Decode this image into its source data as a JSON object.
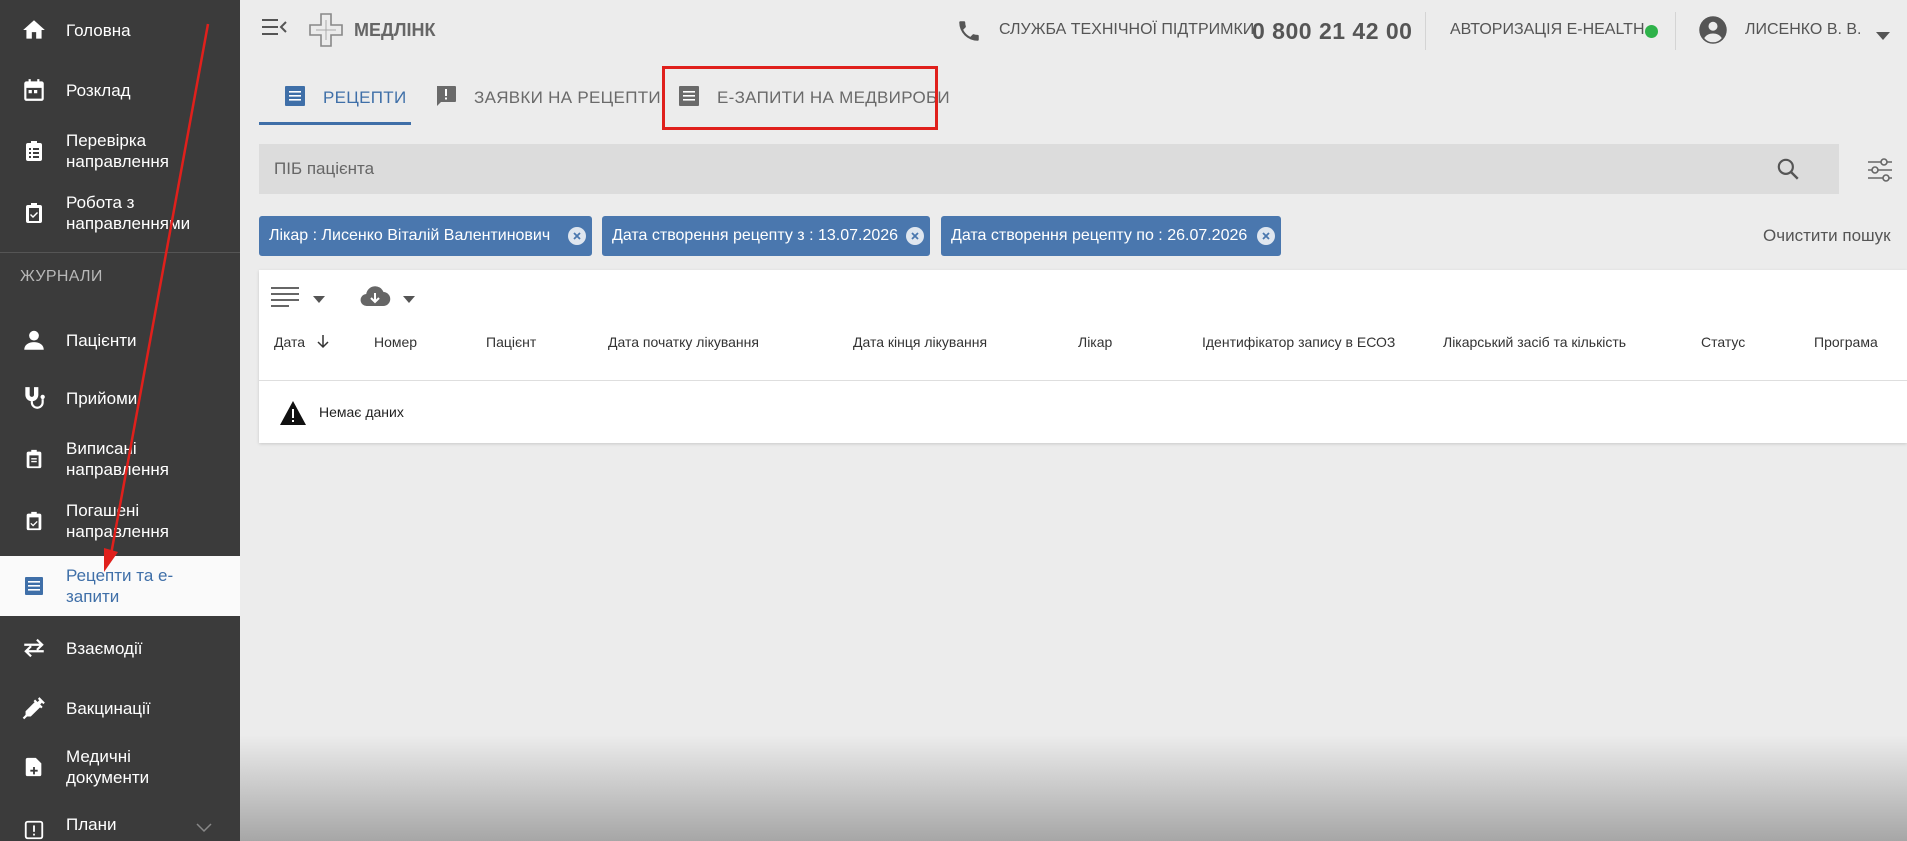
{
  "sidebar": {
    "items": [
      {
        "label": "Головна",
        "icon": "home-icon"
      },
      {
        "label": "Розклад",
        "icon": "calendar-icon"
      },
      {
        "label": "Перевірка направлення",
        "icon": "clipboard-check-icon"
      },
      {
        "label": "Робота з направленнями",
        "icon": "clipboard-icon"
      },
      {
        "label": "Пацієнти",
        "icon": "person-icon"
      },
      {
        "label": "Прийоми",
        "icon": "stethoscope-icon"
      },
      {
        "label": "Виписані направлення",
        "icon": "clipboard-list-icon"
      },
      {
        "label": "Погашені направлення",
        "icon": "clipboard-done-icon"
      },
      {
        "label": "Рецепти та е-запити",
        "icon": "list-icon"
      },
      {
        "label": "Взаємодії",
        "icon": "swap-icon"
      },
      {
        "label": "Вакцинації",
        "icon": "syringe-icon"
      },
      {
        "label": "Медичні документи",
        "icon": "document-plus-icon"
      },
      {
        "label": "Плани",
        "icon": "plans-icon"
      }
    ],
    "section_journals": "ЖУРНАЛИ",
    "active_index": 8
  },
  "header": {
    "logo_text": "МЕДЛІНК",
    "support_label": "СЛУЖБА ТЕХНІЧНОЇ ПІДТРИМКИ",
    "support_phone": "0 800 21 42 00",
    "ehealth_label": "АВТОРИЗАЦІЯ E-HEALTH",
    "ehealth_status_color": "#2eb24a",
    "user_name": "ЛИСЕНКО В. В."
  },
  "tabs": [
    {
      "label": "РЕЦЕПТИ",
      "icon": "list-icon",
      "active": true
    },
    {
      "label": "ЗАЯВКИ НА РЕЦЕПТИ",
      "icon": "alert-box-icon",
      "active": false
    },
    {
      "label": "Е-ЗАПИТИ НА МЕДВИРОБИ",
      "icon": "list-icon",
      "active": false
    }
  ],
  "search": {
    "placeholder": "ПІБ пацієнта"
  },
  "filters": {
    "chips": [
      "Лікар : Лисенко Віталій Валентинович",
      "Дата створення рецепту з : 13.07.2026",
      "Дата створення рецепту по : 26.07.2026"
    ],
    "clear_label": "Очистити пошук"
  },
  "table": {
    "columns": [
      "Дата",
      "Номер",
      "Пацієнт",
      "Дата початку лікування",
      "Дата кінця лікування",
      "Лікар",
      "Ідентифікатор запису в ЕСОЗ",
      "Лікарський засіб та кількість",
      "Статус",
      "Програма"
    ],
    "sort_column": "Дата",
    "sort_direction": "descending",
    "empty_text": "Немає даних"
  },
  "colors": {
    "accent": "#3f6fa8",
    "chip": "#4a77ae",
    "sidebar": "#3b3b3b",
    "annotation": "#e0201c"
  }
}
